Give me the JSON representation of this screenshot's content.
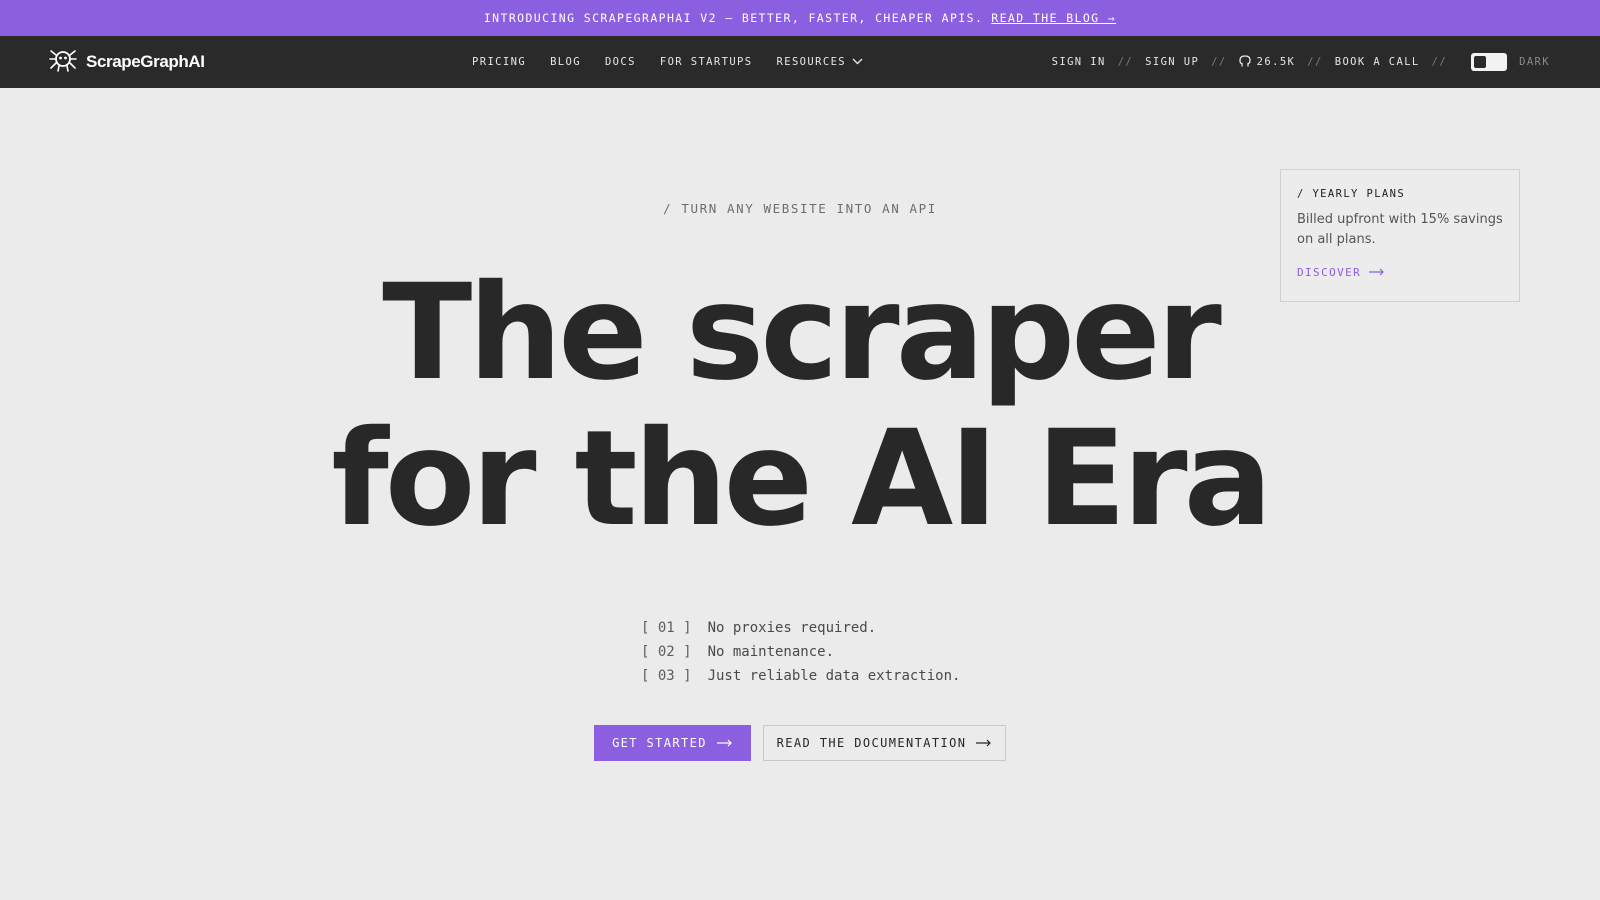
{
  "announcement": {
    "text": "INTRODUCING SCRAPEGRAPHAI V2 — BETTER, FASTER, CHEAPER APIS.",
    "link": "READ THE BLOG →"
  },
  "nav": {
    "brand": "ScrapeGraphAI",
    "items": [
      {
        "label": "PRICING"
      },
      {
        "label": "BLOG"
      },
      {
        "label": "DOCS"
      },
      {
        "label": "FOR STARTUPS"
      },
      {
        "label": "RESOURCES"
      }
    ],
    "sign_in": "SIGN IN",
    "sign_up": "SIGN UP",
    "github_stars": "26.5K",
    "book_call": "BOOK A CALL",
    "separator": "//",
    "theme_label": "DARK"
  },
  "hero": {
    "eyebrow": "/ TURN ANY WEBSITE INTO AN API",
    "headline_line1": "The scraper",
    "headline_line2": "for the AI Era",
    "features": [
      {
        "num": "[ 01 ]",
        "text": "No proxies required."
      },
      {
        "num": "[ 02 ]",
        "text": "No maintenance."
      },
      {
        "num": "[ 03 ]",
        "text": "Just reliable data extraction."
      }
    ],
    "cta_primary": "GET STARTED",
    "cta_secondary": "READ THE DOCUMENTATION"
  },
  "yearly_card": {
    "title": "/ YEARLY PLANS",
    "body": "Billed upfront with 15% savings on all plans.",
    "link": "DISCOVER"
  },
  "colors": {
    "accent": "#8c5ee0",
    "nav_bg": "#2a2a2a",
    "page_bg": "#ebebeb"
  },
  "icons": {
    "logo": "spider-logo-icon",
    "resources_chevron": "chevron-down-icon",
    "github": "github-icon",
    "arrow": "arrow-right-icon"
  }
}
